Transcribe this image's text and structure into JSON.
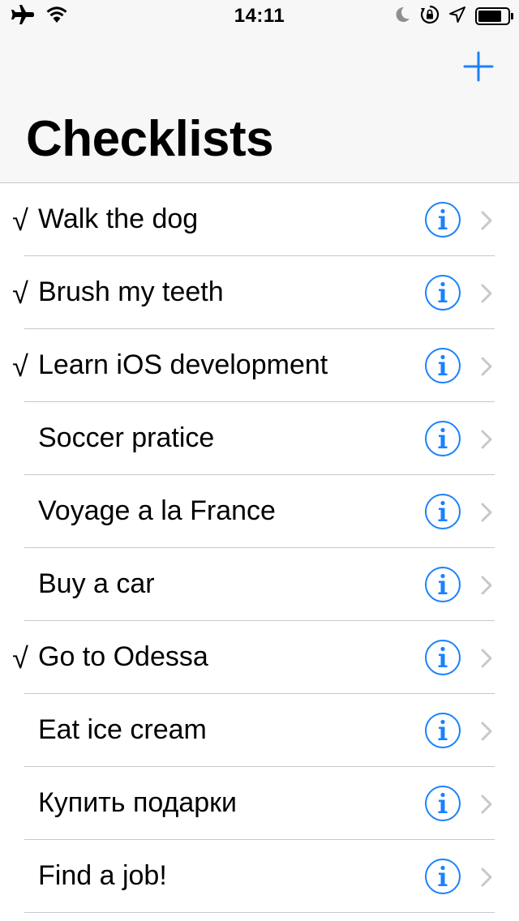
{
  "status_bar": {
    "time": "14:11",
    "icons": [
      "airplane-icon",
      "wifi-icon",
      "moon-icon",
      "rotation-lock-icon",
      "location-icon",
      "battery-icon"
    ]
  },
  "nav": {
    "title": "Checklists",
    "add_icon": "plus-icon"
  },
  "colors": {
    "accent": "#1a82fb",
    "chevron": "#c7c7cc",
    "separator": "#c8c7cc",
    "header_bg": "#f7f7f7"
  },
  "checkmark": "√",
  "items": [
    {
      "label": "Walk the dog",
      "checked": true
    },
    {
      "label": "Brush my teeth",
      "checked": true
    },
    {
      "label": "Learn iOS development",
      "checked": true
    },
    {
      "label": "Soccer pratice",
      "checked": false
    },
    {
      "label": "Voyage a la France",
      "checked": false
    },
    {
      "label": "Buy a car",
      "checked": false
    },
    {
      "label": "Go to Odessa",
      "checked": true
    },
    {
      "label": "Eat ice cream",
      "checked": false
    },
    {
      "label": "Купить подарки",
      "checked": false
    },
    {
      "label": "Find a job!",
      "checked": false
    }
  ]
}
